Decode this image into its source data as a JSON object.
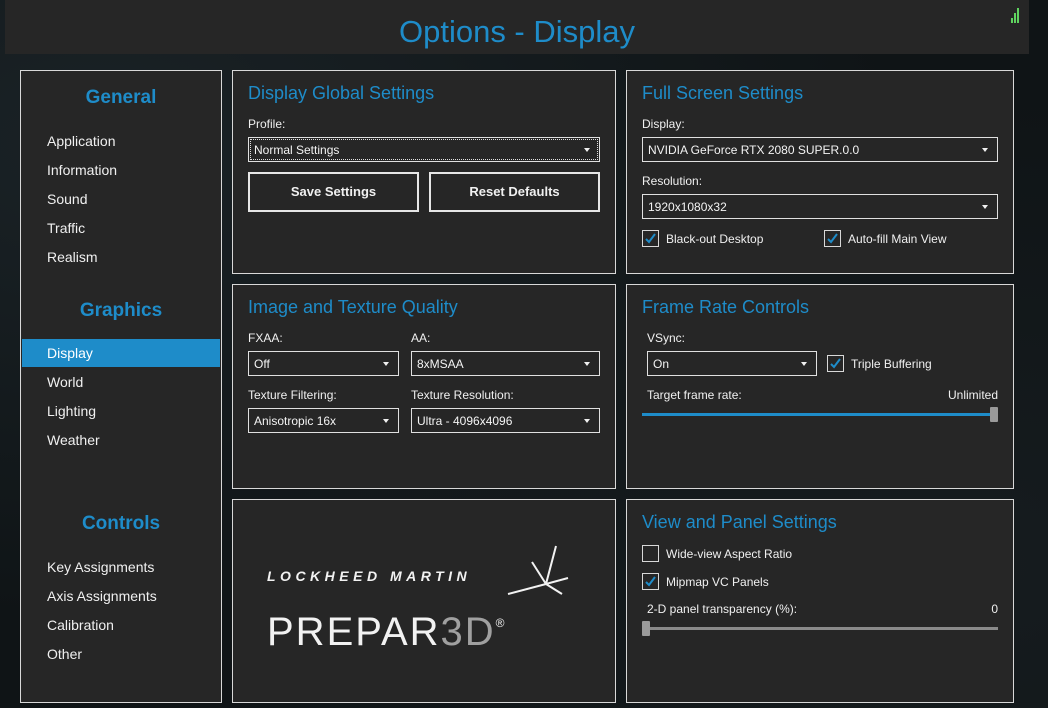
{
  "window": {
    "title": "Options - Display"
  },
  "sidebar": {
    "sections": [
      {
        "heading": "General",
        "items": [
          "Application",
          "Information",
          "Sound",
          "Traffic",
          "Realism"
        ]
      },
      {
        "heading": "Graphics",
        "items": [
          "Display",
          "World",
          "Lighting",
          "Weather"
        ]
      },
      {
        "heading": "Controls",
        "items": [
          "Key Assignments",
          "Axis Assignments",
          "Calibration",
          "Other"
        ]
      }
    ],
    "active_item": "Display"
  },
  "display_global": {
    "heading": "Display Global Settings",
    "profile_label": "Profile:",
    "profile_value": "Normal Settings",
    "save_label": "Save Settings",
    "reset_label": "Reset Defaults"
  },
  "full_screen": {
    "heading": "Full Screen Settings",
    "display_label": "Display:",
    "display_value": "NVIDIA GeForce RTX 2080 SUPER.0.0",
    "resolution_label": "Resolution:",
    "resolution_value": "1920x1080x32",
    "blackout_label": "Black-out Desktop",
    "blackout_checked": true,
    "autofill_label": "Auto-fill Main View",
    "autofill_checked": true
  },
  "image_texture": {
    "heading": "Image and Texture Quality",
    "fxaa_label": "FXAA:",
    "fxaa_value": "Off",
    "aa_label": "AA:",
    "aa_value": "8xMSAA",
    "filtering_label": "Texture Filtering:",
    "filtering_value": "Anisotropic 16x",
    "resolution_label": "Texture Resolution:",
    "resolution_value": "Ultra - 4096x4096"
  },
  "frame_rate": {
    "heading": "Frame Rate Controls",
    "vsync_label": "VSync:",
    "vsync_value": "On",
    "triple_label": "Triple Buffering",
    "triple_checked": true,
    "target_label": "Target frame rate:",
    "target_value": "Unlimited",
    "target_fraction": 1.0
  },
  "logo": {
    "lm_text": "LOCKHEED MARTIN",
    "p3d_main": "PREPAR",
    "p3d_accent": "3D",
    "p3d_mark": "®"
  },
  "view_panel": {
    "heading": "View and Panel Settings",
    "wideview_label": "Wide-view Aspect Ratio",
    "wideview_checked": false,
    "mipmap_label": "Mipmap VC Panels",
    "mipmap_checked": true,
    "transparency_label": "2-D panel transparency (%):",
    "transparency_value": "0",
    "transparency_fraction": 0.0
  },
  "colors": {
    "accent": "#1e8cc9",
    "panel": "#262626",
    "border": "#d8d8d8"
  }
}
